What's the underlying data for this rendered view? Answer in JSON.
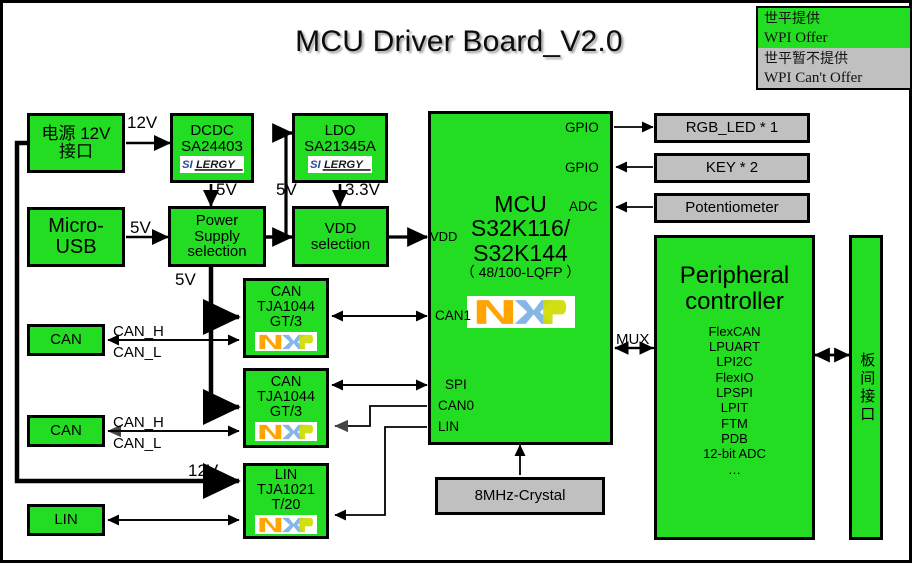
{
  "page": {
    "title": "MCU Driver Board_V2.0",
    "colors": {
      "green": "#22dd22",
      "gray": "#c0c0c0",
      "border": "#000000",
      "background": "#ffffff"
    }
  },
  "legend": {
    "offered_cn": "世平提供",
    "offered_en": "WPI Offer",
    "not_offered_cn": "世平暂不提供",
    "not_offered_en": "WPI Can't Offer"
  },
  "blocks": {
    "power_12v": {
      "line1": "电源 12V",
      "line2": "接口"
    },
    "micro_usb": {
      "line1": "Micro-",
      "line2": "USB"
    },
    "dcdc": {
      "line1": "DCDC",
      "line2": "SA24403",
      "logo": "silergy-logo"
    },
    "ldo": {
      "line1": "LDO",
      "line2": "SA21345A",
      "logo": "silergy-logo"
    },
    "power_supply_selection": {
      "line1": "Power",
      "line2": "Supply",
      "line3": "selection"
    },
    "vdd_selection": {
      "line1": "VDD",
      "line2": "selection"
    },
    "mcu": {
      "label": "MCU",
      "part": "S32K116/",
      "part2": "S32K144",
      "package": "（ 48/100-LQFP ）",
      "logo": "nxp-logo",
      "pins": {
        "gpio1": "GPIO",
        "gpio2": "GPIO",
        "adc": "ADC",
        "vdd": "VDD",
        "can1": "CAN1",
        "spi": "SPI",
        "can0": "CAN0",
        "lin": "LIN"
      }
    },
    "can_transceiver_1": {
      "line1": "CAN",
      "line2": "TJA1044",
      "line3": "GT/3",
      "logo": "nxp-logo"
    },
    "can_transceiver_2": {
      "line1": "CAN",
      "line2": "TJA1044",
      "line3": "GT/3",
      "logo": "nxp-logo"
    },
    "lin_transceiver": {
      "line1": "LIN",
      "line2": "TJA1021",
      "line3": "T/20",
      "logo": "nxp-logo"
    },
    "can_connector_1": {
      "label": "CAN"
    },
    "can_connector_2": {
      "label": "CAN"
    },
    "lin_connector": {
      "label": "LIN"
    },
    "rgb_led": {
      "label": "RGB_LED * 1"
    },
    "key": {
      "label": "KEY * 2"
    },
    "potentiometer": {
      "label": "Potentiometer"
    },
    "crystal": {
      "label": "8MHz-Crystal"
    },
    "peripheral_controller": {
      "line1": "Peripheral",
      "line2": "controller",
      "items": [
        "FlexCAN",
        "LPUART",
        "LPI2C",
        "FlexIO",
        "LPSPI",
        "LPIT",
        "FTM",
        "PDB",
        "12-bit ADC",
        "…"
      ]
    },
    "board_interface": {
      "label": "板间接口"
    }
  },
  "wire_labels": {
    "v12_from_power": "12V",
    "v5_from_dcdc": "5V",
    "v5_to_ldo": "5V",
    "v33_from_ldo": "3.3V",
    "v5_from_usb": "5V",
    "v5_to_can": "5V",
    "v12_to_lin": "12V",
    "can_h_1": "CAN_H",
    "can_l_1": "CAN_L",
    "can_h_2": "CAN_H",
    "can_l_2": "CAN_L",
    "mux": "MUX"
  },
  "logos": {
    "silergy": {
      "part1": "SI",
      "part2": "L",
      "part3": "ERGY"
    },
    "nxp": {
      "text": "NXP"
    }
  }
}
